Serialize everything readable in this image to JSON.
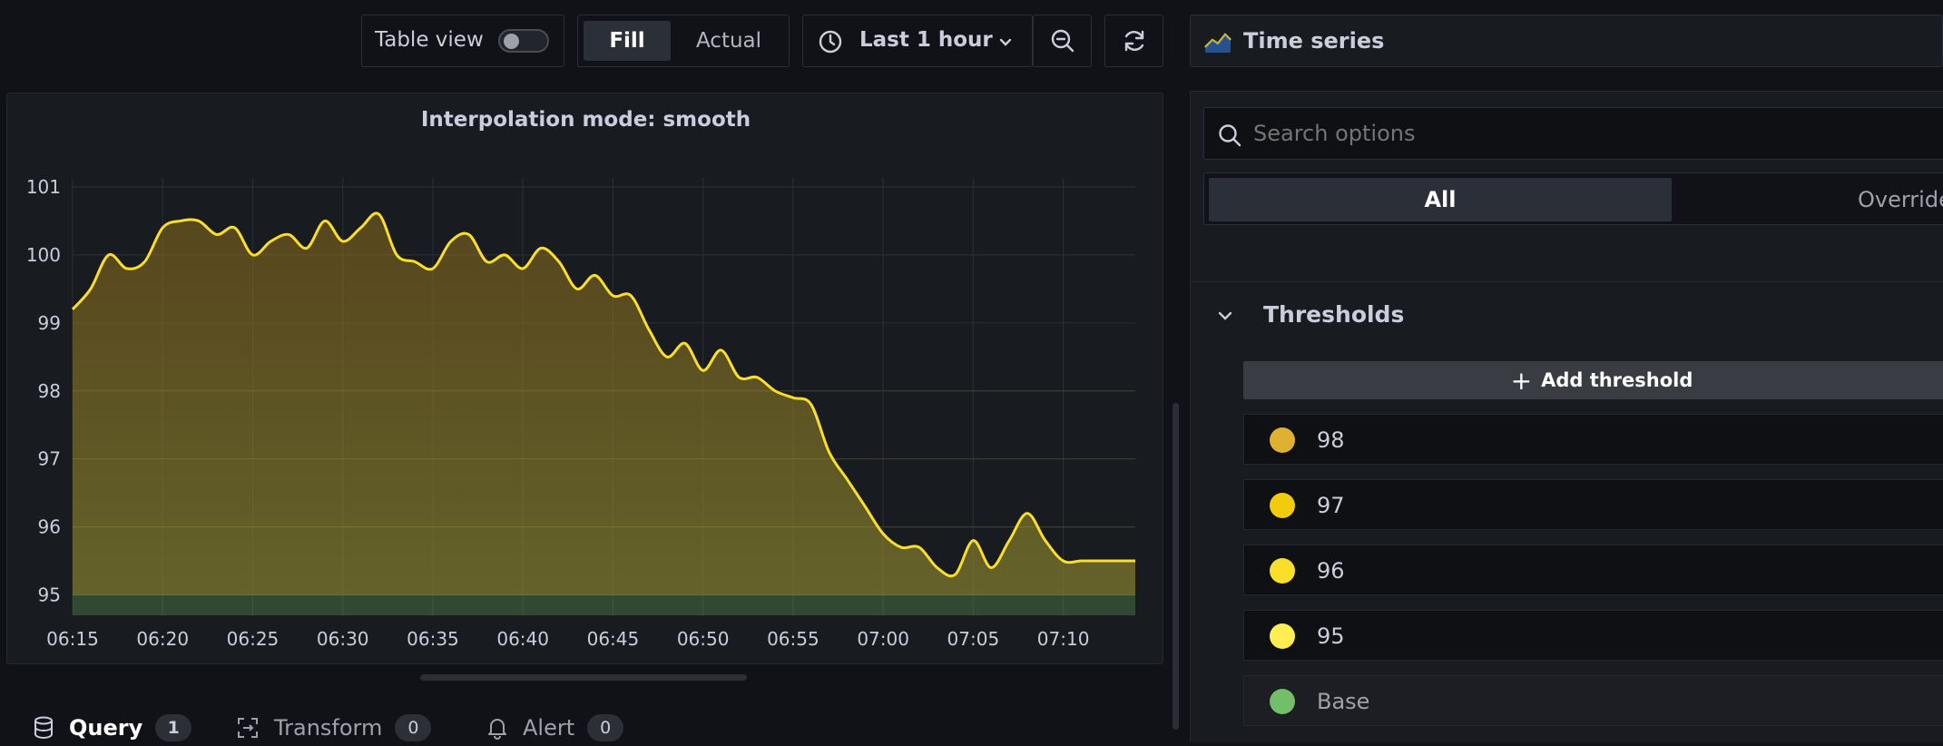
{
  "toolbar": {
    "table_view_label": "Table view",
    "table_view_on": false,
    "fill_label": "Fill",
    "actual_label": "Actual",
    "time_range": "Last 1 hour",
    "visualization": "Time series"
  },
  "panel": {
    "title": "Interpolation mode: smooth"
  },
  "chart_data": {
    "type": "area",
    "title": "Interpolation mode: smooth",
    "xlabel": "",
    "ylabel": "",
    "x_ticks": [
      "06:15",
      "06:20",
      "06:25",
      "06:30",
      "06:35",
      "06:40",
      "06:45",
      "06:50",
      "06:55",
      "07:00",
      "07:05",
      "07:10"
    ],
    "y_ticks": [
      101,
      100,
      99,
      98,
      97,
      96,
      95
    ],
    "xlim": [
      "06:15",
      "07:14"
    ],
    "ylim": [
      94.7,
      101.2
    ],
    "grid": true,
    "line_color": "#fade2a",
    "x": [
      "06:15",
      "06:16",
      "06:17",
      "06:18",
      "06:19",
      "06:20",
      "06:21",
      "06:22",
      "06:23",
      "06:24",
      "06:25",
      "06:26",
      "06:27",
      "06:28",
      "06:29",
      "06:30",
      "06:31",
      "06:32",
      "06:33",
      "06:34",
      "06:35",
      "06:36",
      "06:37",
      "06:38",
      "06:39",
      "06:40",
      "06:41",
      "06:42",
      "06:43",
      "06:44",
      "06:45",
      "06:46",
      "06:47",
      "06:48",
      "06:49",
      "06:50",
      "06:51",
      "06:52",
      "06:53",
      "06:54",
      "06:55",
      "06:56",
      "06:57",
      "06:58",
      "06:59",
      "07:00",
      "07:01",
      "07:02",
      "07:03",
      "07:04",
      "07:05",
      "07:06",
      "07:07",
      "07:08",
      "07:09",
      "07:10",
      "07:11",
      "07:12",
      "07:13",
      "07:14"
    ],
    "values": [
      99.2,
      99.5,
      100.0,
      99.8,
      99.9,
      100.4,
      100.5,
      100.5,
      100.3,
      100.4,
      100.0,
      100.2,
      100.3,
      100.1,
      100.5,
      100.2,
      100.4,
      100.6,
      100.0,
      99.9,
      99.8,
      100.2,
      100.3,
      99.9,
      100.0,
      99.8,
      100.1,
      99.9,
      99.5,
      99.7,
      99.4,
      99.4,
      98.9,
      98.5,
      98.7,
      98.3,
      98.6,
      98.2,
      98.2,
      98.0,
      97.9,
      97.8,
      97.1,
      96.7,
      96.3,
      95.9,
      95.7,
      95.7,
      95.4,
      95.3,
      95.8,
      95.4,
      95.8,
      96.2,
      95.8,
      95.5,
      95.5,
      95.5,
      95.5,
      95.5
    ],
    "thresholds": [
      {
        "value": 98,
        "color": "#e0b131"
      },
      {
        "value": 97,
        "color": "#f2cc0c"
      },
      {
        "value": 96,
        "color": "#fade2a"
      },
      {
        "value": 95,
        "color": "#ffee52"
      },
      {
        "value": "Base",
        "color": "#73bf69"
      }
    ]
  },
  "bottom_tabs": {
    "query": {
      "label": "Query",
      "count": "1"
    },
    "transform": {
      "label": "Transform",
      "count": "0"
    },
    "alert": {
      "label": "Alert",
      "count": "0"
    }
  },
  "options": {
    "search_placeholder": "Search options",
    "tab_all": "All",
    "tab_overrides": "Override",
    "section_title": "Thresholds",
    "add_threshold": "Add threshold",
    "threshold_values": [
      "98",
      "97",
      "96",
      "95",
      "Base"
    ],
    "threshold_colors": [
      "#e0b131",
      "#f2cc0c",
      "#fade2a",
      "#ffee52",
      "#73bf69"
    ]
  }
}
